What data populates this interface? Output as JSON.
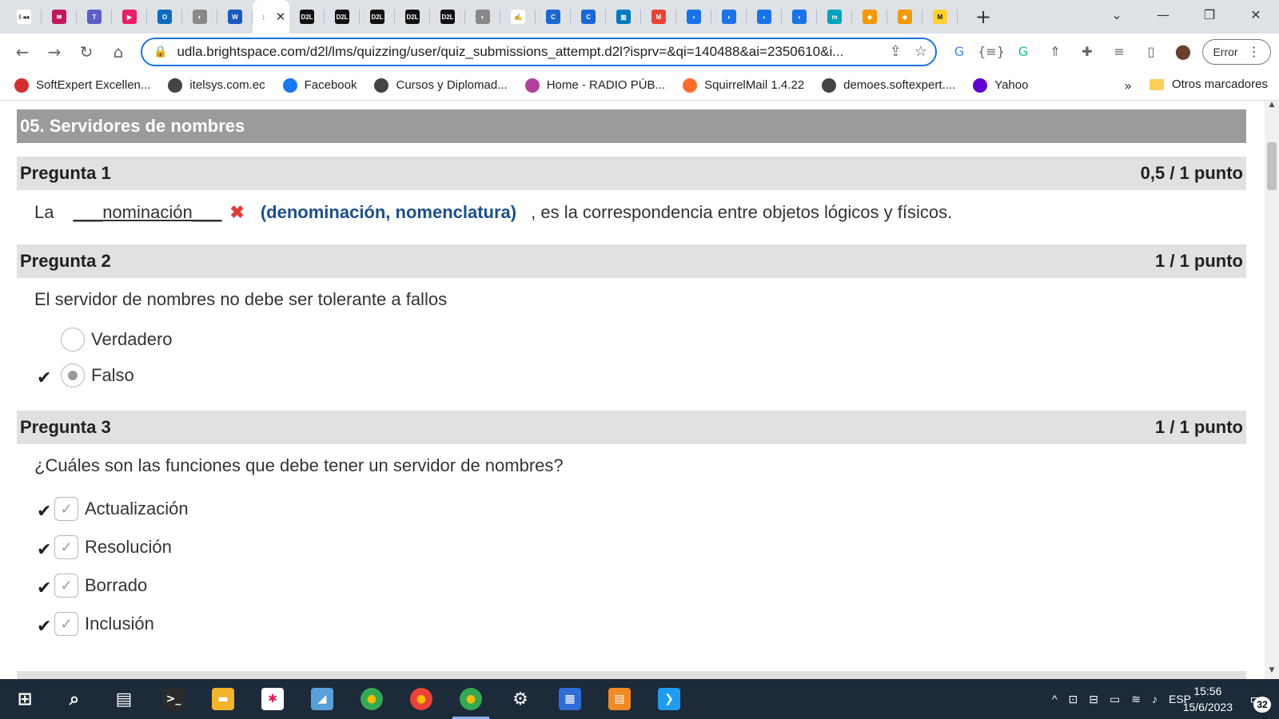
{
  "browser": {
    "tabs": [
      {
        "icon": "media-icon",
        "color": "#ffffff",
        "text": "I ◂◂"
      },
      {
        "icon": "mail-icon",
        "color": "#c2185b",
        "text": "✉"
      },
      {
        "icon": "teams-icon",
        "color": "#5b5fc7",
        "text": "T"
      },
      {
        "icon": "play-icon",
        "color": "#e91e63",
        "text": "▶"
      },
      {
        "icon": "outlook-icon",
        "color": "#0f6cbd",
        "text": "O"
      },
      {
        "icon": "globe-icon",
        "color": "#888888",
        "text": "◐"
      },
      {
        "icon": "word-icon",
        "color": "#185abd",
        "text": "W"
      },
      {
        "icon": "active-tab-icon",
        "color": "#ffffff",
        "text": ":",
        "active": true
      },
      {
        "icon": "d2l-icon",
        "color": "#111111",
        "text": "D2L"
      },
      {
        "icon": "d2l-icon",
        "color": "#111111",
        "text": "D2L"
      },
      {
        "icon": "d2l-icon",
        "color": "#111111",
        "text": "D2L"
      },
      {
        "icon": "d2l-icon",
        "color": "#111111",
        "text": "D2L"
      },
      {
        "icon": "d2l-icon",
        "color": "#111111",
        "text": "D2L"
      },
      {
        "icon": "globe-icon",
        "color": "#888888",
        "text": "◐"
      },
      {
        "icon": "sign-icon",
        "color": "#ffffff",
        "text": "✍"
      },
      {
        "icon": "c-icon",
        "color": "#1967d2",
        "text": "C"
      },
      {
        "icon": "c-icon",
        "color": "#1967d2",
        "text": "C"
      },
      {
        "icon": "trello-icon",
        "color": "#0079bf",
        "text": "▥"
      },
      {
        "icon": "gmail-icon",
        "color": "#ea4335",
        "text": "M"
      },
      {
        "icon": "edge-icon",
        "color": "#1a73e8",
        "text": "◗"
      },
      {
        "icon": "edge-icon",
        "color": "#1a73e8",
        "text": "◗"
      },
      {
        "icon": "edge-icon",
        "color": "#1a73e8",
        "text": "◗"
      },
      {
        "icon": "edge-icon",
        "color": "#1a73e8",
        "text": "◗"
      },
      {
        "icon": "m-icon",
        "color": "#00a3bf",
        "text": "m"
      },
      {
        "icon": "note-icon",
        "color": "#f29900",
        "text": "◆"
      },
      {
        "icon": "note-icon",
        "color": "#f29900",
        "text": "◆"
      },
      {
        "icon": "miro-icon",
        "color": "#ffd02f",
        "text": "M"
      }
    ],
    "close_glyph": "✕",
    "new_tab_glyph": "+",
    "window_controls": {
      "chevron": "⌄",
      "minimize": "—",
      "restore": "❐",
      "close": "✕"
    },
    "nav": {
      "back": "←",
      "forward": "→",
      "reload": "↻",
      "home": "⌂"
    },
    "url": "udla.brightspace.com/d2l/lms/quizzing/user/quiz_submissions_attempt.d2l?isprv=&qi=140488&ai=2350610&i...",
    "omnibox_icons": {
      "share": "⇪",
      "star": "☆"
    },
    "extensions": [
      {
        "name": "translate-icon",
        "glyph": "G"
      },
      {
        "name": "json-icon",
        "glyph": "{≡}"
      },
      {
        "name": "grammarly-icon",
        "glyph": "G"
      },
      {
        "name": "ext-grey-icon",
        "glyph": "⇑"
      },
      {
        "name": "puzzle-icon",
        "glyph": "✚"
      },
      {
        "name": "media-queue-icon",
        "glyph": "≡"
      },
      {
        "name": "sidepanel-icon",
        "glyph": "▯"
      },
      {
        "name": "avatar-icon",
        "glyph": "●"
      }
    ],
    "profile_label": "Error",
    "profile_menu": "⋮",
    "bookmarks": [
      {
        "icon": "softexpert-icon",
        "color": "#d32f2f",
        "label": "SoftExpert Excellen..."
      },
      {
        "icon": "globe-icon",
        "color": "#444444",
        "label": "itelsys.com.ec"
      },
      {
        "icon": "facebook-icon",
        "color": "#1877f2",
        "label": "Facebook"
      },
      {
        "icon": "globe-icon",
        "color": "#444444",
        "label": "Cursos y Diplomad..."
      },
      {
        "icon": "radio-icon",
        "color": "#b0419d",
        "label": "Home - RADIO PÚB..."
      },
      {
        "icon": "cpanel-icon",
        "color": "#ff6c2c",
        "label": "SquirrelMail 1.4.22"
      },
      {
        "icon": "globe-icon",
        "color": "#444444",
        "label": "demoes.softexpert...."
      },
      {
        "icon": "yahoo-icon",
        "color": "#6001d2",
        "label": "Yahoo"
      }
    ],
    "bookmarks_more": "»",
    "other_bookmarks": "Otros marcadores"
  },
  "quiz": {
    "section_title": "05. Servidores de nombres",
    "questions": [
      {
        "title": "Pregunta 1",
        "score": "0,5 / 1 punto",
        "prefix": "La",
        "answer": "___nominación___",
        "wrong_mark": "✖",
        "correct_answer": "(denominación, nomenclatura)",
        "suffix": ", es la correspondencia entre objetos lógicos y físicos."
      },
      {
        "title": "Pregunta 2",
        "score": "1 / 1 punto",
        "text": "El servidor de nombres no debe ser tolerante a fallos",
        "options": [
          {
            "label": "Verdadero",
            "selected": false,
            "correct": false
          },
          {
            "label": "Falso",
            "selected": true,
            "correct": true
          }
        ]
      },
      {
        "title": "Pregunta 3",
        "score": "1 / 1 punto",
        "text": "¿Cuáles son las funciones que debe tener un servidor de nombres?",
        "options": [
          {
            "label": "Actualización",
            "checked": true,
            "correct": true
          },
          {
            "label": "Resolución",
            "checked": true,
            "correct": true
          },
          {
            "label": "Borrado",
            "checked": true,
            "correct": true
          },
          {
            "label": "Inclusión",
            "checked": true,
            "correct": true
          }
        ]
      }
    ],
    "tick_glyph": "✔",
    "checkbox_glyph": "✓"
  },
  "taskbar": {
    "apps": [
      {
        "name": "start-icon",
        "color": "#1c2a3a",
        "glyph": "⊞"
      },
      {
        "name": "search-icon",
        "color": "#1c2a3a",
        "glyph": "⌕"
      },
      {
        "name": "task-view-icon",
        "color": "#1c2a3a",
        "glyph": "▤"
      },
      {
        "name": "terminal-icon",
        "color": "#2b2b2b",
        "glyph": ">_"
      },
      {
        "name": "file-explorer-icon",
        "color": "#f3b52b",
        "glyph": "▬"
      },
      {
        "name": "slack-icon",
        "color": "#ffffff",
        "glyph": "✱"
      },
      {
        "name": "notes-icon",
        "color": "#5aa0d8",
        "glyph": "◢"
      },
      {
        "name": "chrome-icon",
        "color": "#34a853",
        "glyph": "●"
      },
      {
        "name": "chrome-profile-icon",
        "color": "#ea4335",
        "glyph": "●"
      },
      {
        "name": "chrome-active-icon",
        "color": "#34a853",
        "glyph": "●",
        "active": true
      },
      {
        "name": "settings-icon",
        "color": "#1c2a3a",
        "glyph": "⚙"
      },
      {
        "name": "calculator-icon",
        "color": "#2f6cd4",
        "glyph": "▦"
      },
      {
        "name": "document-icon",
        "color": "#f08a24",
        "glyph": "▤"
      },
      {
        "name": "vscode-icon",
        "color": "#1f9cf0",
        "glyph": "❯"
      }
    ],
    "tray_icons": [
      "^",
      "⊡",
      "⊟",
      "▭",
      "≋",
      "♪"
    ],
    "language": "ESP",
    "time": "15:56",
    "date": "15/6/2023",
    "notification_glyph": "▭",
    "notification_count": "32"
  }
}
